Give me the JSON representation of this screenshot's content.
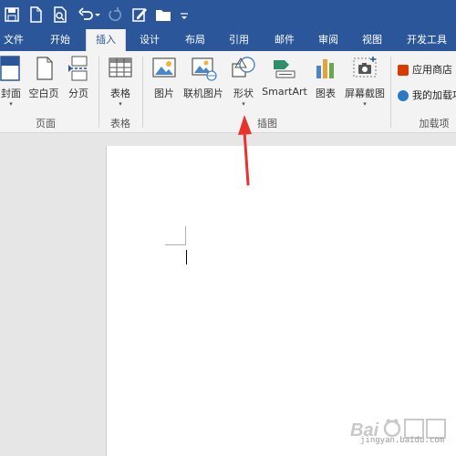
{
  "tabs": [
    "文件",
    "开始",
    "插入",
    "设计",
    "布局",
    "引用",
    "邮件",
    "审阅",
    "视图",
    "开发工具"
  ],
  "active_tab": "插入",
  "ribbon": {
    "pages_group": {
      "label": "页面",
      "cover": "封面",
      "blank_page": "空白页",
      "page_break": "分页"
    },
    "table_group": {
      "label": "表格",
      "table": "表格"
    },
    "illustrations_group": {
      "label": "插图",
      "pictures": "图片",
      "online_pictures": "联机图片",
      "shapes": "形状",
      "smartart": "SmartArt",
      "chart": "图表",
      "screenshot": "屏幕截图"
    },
    "addins_group": {
      "label": "加载项",
      "store": "应用商店",
      "my_addins": "我的加载项"
    }
  },
  "colors": {
    "title_bar": "#2b579a",
    "annotation_arrow": "#e8322c"
  },
  "watermark": {
    "text": "jingyan.baidu.com"
  }
}
